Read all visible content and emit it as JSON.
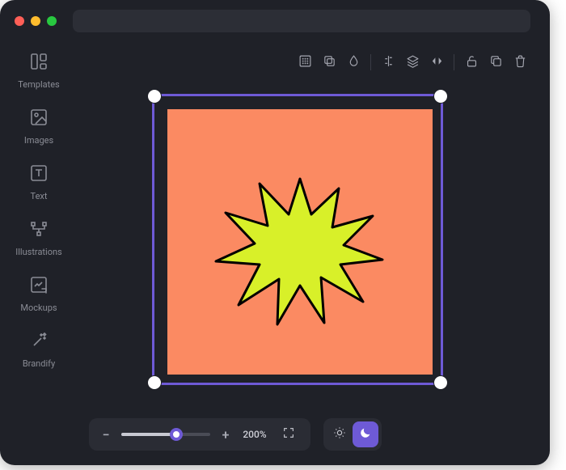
{
  "sidebar": {
    "items": [
      {
        "label": "Templates"
      },
      {
        "label": "Images"
      },
      {
        "label": "Text"
      },
      {
        "label": "Illustrations"
      },
      {
        "label": "Mockups"
      },
      {
        "label": "Brandify"
      }
    ]
  },
  "toolbar": {
    "icons": [
      "grid",
      "duplicate",
      "mask",
      "align",
      "layers",
      "flip",
      "lock",
      "copy",
      "delete"
    ]
  },
  "zoom": {
    "value_label": "200%",
    "percent": 62
  },
  "theme": {
    "active": "dark"
  },
  "canvas": {
    "artboard_color": "#fb8a62",
    "selection_color": "#6e5ad6",
    "burst_fill": "#d8f029",
    "burst_stroke": "#000000"
  }
}
